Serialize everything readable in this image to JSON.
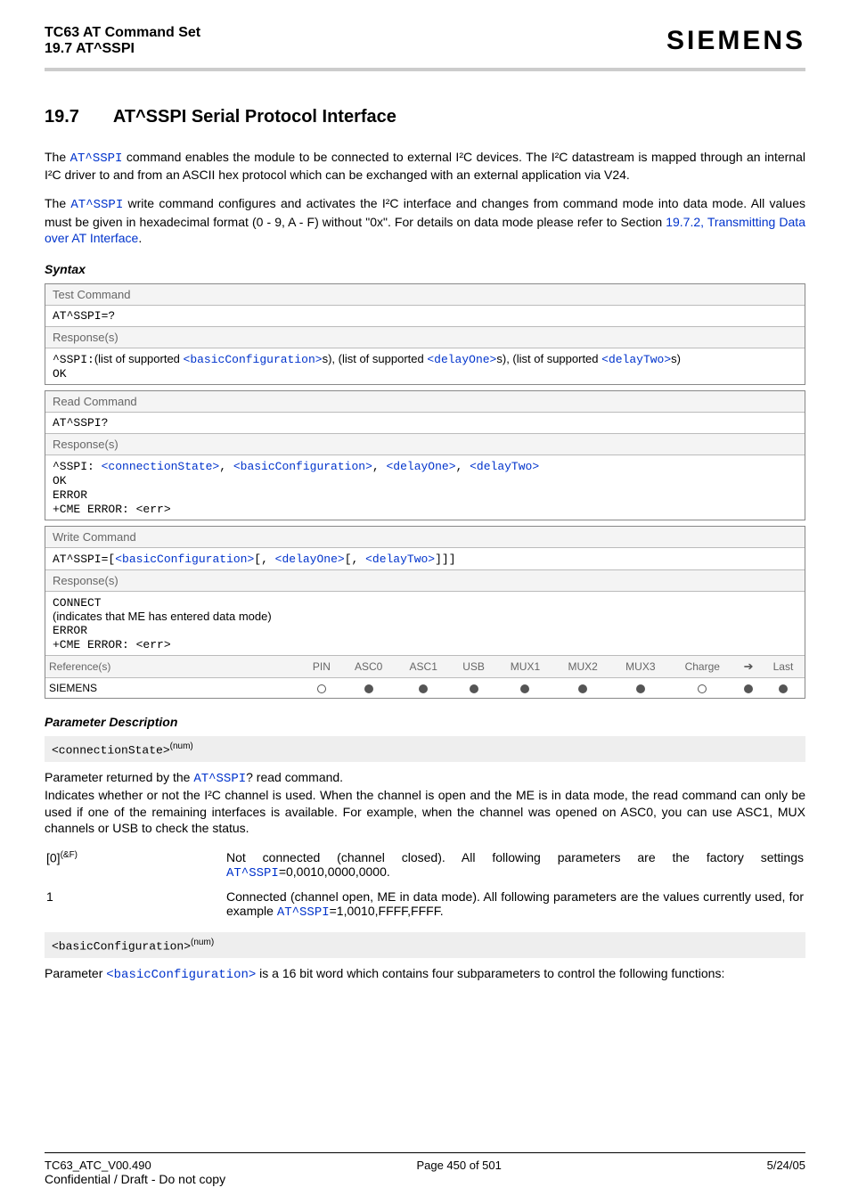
{
  "header": {
    "doc_title": "TC63 AT Command Set",
    "section_ref": "19.7 AT^SSPI",
    "brand": "SIEMENS"
  },
  "section": {
    "number": "19.7",
    "title": "AT^SSPI   Serial Protocol Interface",
    "intro1_pre": "The ",
    "intro1_cmd": "AT^SSPI",
    "intro1_post": " command enables the module to be connected to external I²C devices. The I²C datastream is mapped through an internal I²C driver to and from an ASCII hex protocol which can be exchanged with an external application via V24.",
    "intro2_pre": "The ",
    "intro2_cmd": "AT^SSPI",
    "intro2_mid": " write command configures and activates the I²C interface and changes from command mode into data mode. All values must be given in hexadecimal format (0 - 9, A - F) without \"0x\". For details on data mode please refer to Section ",
    "intro2_link": "19.7.2, Transmitting Data over AT Interface",
    "intro2_end": "."
  },
  "syntax_heading": "Syntax",
  "syntax": {
    "test": {
      "label": "Test Command",
      "cmd": "AT^SSPI=?",
      "resp_label": "Response(s)",
      "resp_prefix": "^SSPI:",
      "resp_t1": "(list of supported ",
      "p1": "<basicConfiguration>",
      "resp_t2": "s), (list of supported ",
      "p2": "<delayOne>",
      "resp_t3": "s), (list of supported ",
      "p3": "<delayTwo>",
      "resp_t4": "s)",
      "ok": "OK"
    },
    "read": {
      "label": "Read Command",
      "cmd": "AT^SSPI?",
      "resp_label": "Response(s)",
      "resp_prefix": "^SSPI: ",
      "p1": "<connectionState>",
      "p2": "<basicConfiguration>",
      "p3": "<delayOne>",
      "p4": "<delayTwo>",
      "ok": "OK",
      "error": "ERROR",
      "cme": "+CME ERROR: <err>"
    },
    "write": {
      "label": "Write Command",
      "cmd_prefix": "AT^SSPI=",
      "br_o": "[",
      "p1": "<basicConfiguration>",
      "sep1": "[, ",
      "p2": "<delayOne>",
      "sep2": "[, ",
      "p3": "<delayTwo>",
      "br_c": "]]]",
      "resp_label": "Response(s)",
      "connect": "CONNECT",
      "note": "(indicates that ME has entered data mode)",
      "error": "ERROR",
      "cme": "+CME ERROR: <err>"
    },
    "ref": {
      "label": "Reference(s)",
      "cols": [
        "PIN",
        "ASC0",
        "ASC1",
        "USB",
        "MUX1",
        "MUX2",
        "MUX3",
        "Charge",
        "➔",
        "Last"
      ],
      "name": "SIEMENS",
      "vals": [
        "open",
        "filled",
        "filled",
        "filled",
        "filled",
        "filled",
        "filled",
        "open",
        "filled",
        "filled"
      ]
    }
  },
  "param_heading": "Parameter Description",
  "params": {
    "connState": {
      "name": "<connectionState>",
      "sup": "(num)",
      "line1_pre": "Parameter returned by the ",
      "line1_cmd": "AT^SSPI",
      "line1_post": "? read command.",
      "desc": "Indicates whether or not the I²C channel is used. When the channel is open and the ME is in data mode, the read command can only be used if one of the remaining interfaces is available. For example, when the channel was opened on ASC0, you can use ASC1, MUX channels or USB to check the status.",
      "v0_key": "[0]",
      "v0_sup": "(&F)",
      "v0_pre": "Not connected (channel closed). All following parameters are the factory settings ",
      "v0_cmd": "AT^SSPI",
      "v0_post": "=0,0010,0000,0000.",
      "v1_key": "1",
      "v1_pre": "Connected (channel open, ME in data mode). All following parameters are the values currently used, for example ",
      "v1_cmd": "AT^SSPI",
      "v1_post": "=1,0010,FFFF,FFFF."
    },
    "basicConf": {
      "name": "<basicConfiguration>",
      "sup": "(num)",
      "desc_pre": "Parameter ",
      "desc_cmd": "<basicConfiguration>",
      "desc_post": " is a 16 bit word which contains four subparameters to control the following functions:"
    }
  },
  "footer": {
    "doc_ver": "TC63_ATC_V00.490",
    "page": "Page 450 of 501",
    "date": "5/24/05",
    "conf": "Confidential / Draft - Do not copy"
  }
}
